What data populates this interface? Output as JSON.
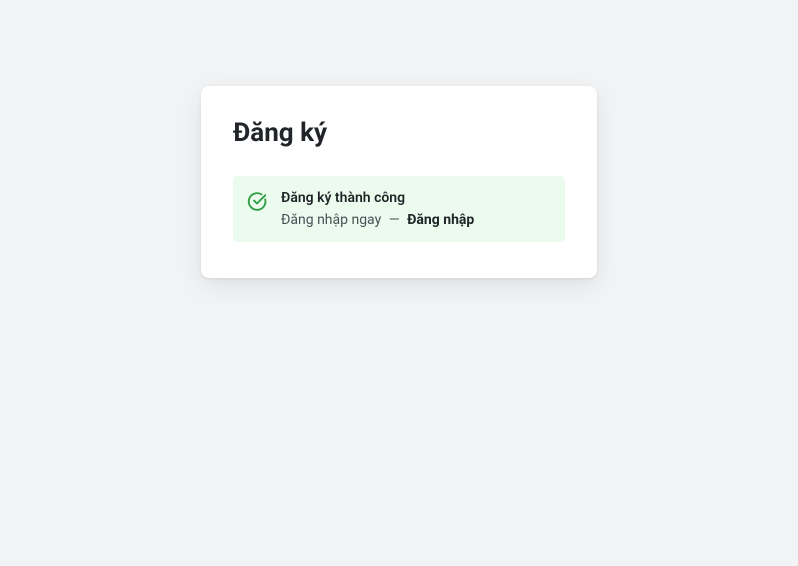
{
  "page": {
    "title": "Đăng ký"
  },
  "alert": {
    "title": "Đăng ký thành công",
    "message_prefix": "Đăng nhập ngay",
    "separator": "—",
    "link_label": "Đăng nhập"
  }
}
